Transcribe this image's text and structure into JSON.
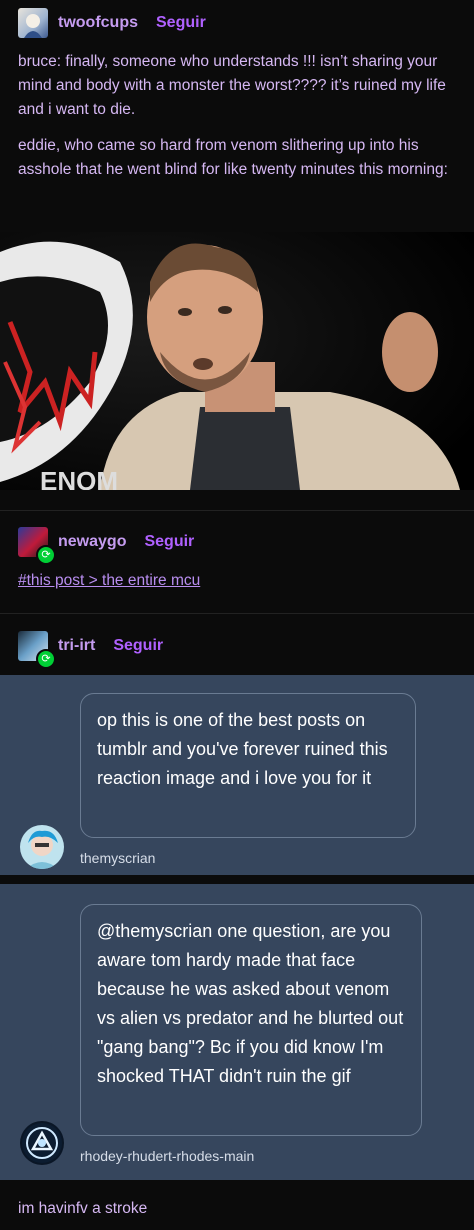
{
  "post1": {
    "username": "twoofcups",
    "follow": "Seguir",
    "paragraphs": [
      "bruce: finally, someone who understands !!! isn’t sharing your mind and body with a monster the worst???? it’s ruined my life and i want to die.",
      "eddie, who came so hard from venom slithering up into his asshole that he went blind for like twenty minutes this morning:"
    ]
  },
  "post2": {
    "username": "newaygo",
    "follow": "Seguir",
    "tag": "#this post > the entire mcu"
  },
  "post3": {
    "username": "tri-irt",
    "follow": "Seguir"
  },
  "embed1": {
    "text": "op this is one of the best posts on tumblr and you've forever ruined this reaction image and i love you for it",
    "author": "themyscrian"
  },
  "embed2": {
    "text": "@themyscrian one question, are you aware tom hardy made that face because he was asked about venom vs alien vs predator  and he blurted out \"gang bang\"? Bc if you did know I'm shocked THAT didn't ruin the gif",
    "author": "rhodey-rhudert-rhodes-main"
  },
  "final": {
    "text": "im havinfv a stroke"
  },
  "colors": {
    "background": "#0b0b0b",
    "username": "#c59cf0",
    "follow": "#b061ff",
    "embed_bg": "#36465d",
    "reblog_badge": "#00cf35"
  }
}
